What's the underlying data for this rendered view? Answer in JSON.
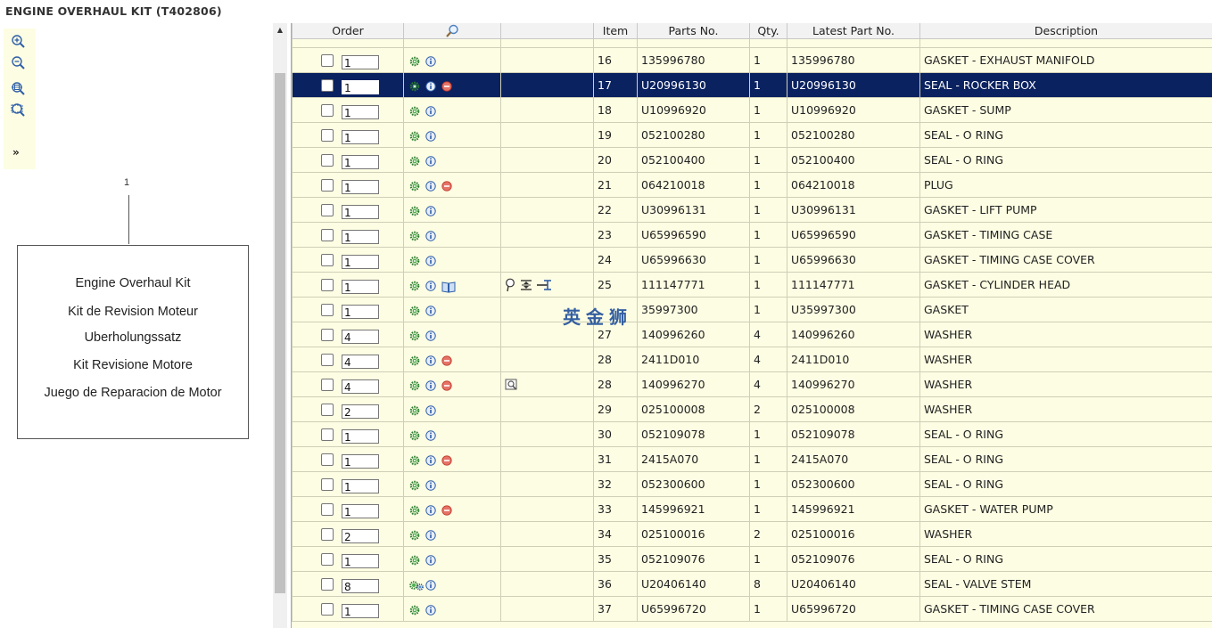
{
  "page": {
    "title": "ENGINE OVERHAUL KIT (T402806)"
  },
  "toolbar": {
    "icons": [
      "zoom-in-icon",
      "zoom-out-icon",
      "zoom-fit-icon",
      "zoom-area-icon"
    ],
    "expand_label": "»"
  },
  "illustration": {
    "callout": "1",
    "lines": [
      "Engine Overhaul Kit",
      "Kit de Revision Moteur",
      "Uberholungssatz",
      "Kit Revisione Motore",
      "Juego de Reparacion de Motor"
    ]
  },
  "watermark": "英金狮",
  "colors": {
    "row_bg": "#fdfde3",
    "selected_bg": "#0b2260",
    "icon_green": "#2e7d32",
    "icon_blue": "#2f5fa8",
    "icon_red": "#d9534f"
  },
  "table": {
    "headers": {
      "order": "Order",
      "item": "Item",
      "parts_no": "Parts No.",
      "qty": "Qty.",
      "latest": "Latest Part No.",
      "description": "Description"
    },
    "rows": [
      {
        "qty_input": "1",
        "item": "16",
        "part": "135996780",
        "qty": "1",
        "latest": "135996780",
        "desc": "GASKET - EXHAUST MANIFOLD",
        "red": false,
        "book": false,
        "extra": ""
      },
      {
        "qty_input": "1",
        "item": "17",
        "part": "U20996130",
        "qty": "1",
        "latest": "U20996130",
        "desc": "SEAL - ROCKER BOX",
        "red": true,
        "book": false,
        "extra": "",
        "selected": true
      },
      {
        "qty_input": "1",
        "item": "18",
        "part": "U10996920",
        "qty": "1",
        "latest": "U10996920",
        "desc": "GASKET - SUMP",
        "red": false,
        "book": false,
        "extra": ""
      },
      {
        "qty_input": "1",
        "item": "19",
        "part": "052100280",
        "qty": "1",
        "latest": "052100280",
        "desc": "SEAL - O RING",
        "red": false,
        "book": false,
        "extra": ""
      },
      {
        "qty_input": "1",
        "item": "20",
        "part": "052100400",
        "qty": "1",
        "latest": "052100400",
        "desc": "SEAL - O RING",
        "red": false,
        "book": false,
        "extra": ""
      },
      {
        "qty_input": "1",
        "item": "21",
        "part": "064210018",
        "qty": "1",
        "latest": "064210018",
        "desc": "PLUG",
        "red": true,
        "book": false,
        "extra": ""
      },
      {
        "qty_input": "1",
        "item": "22",
        "part": "U30996131",
        "qty": "1",
        "latest": "U30996131",
        "desc": "GASKET - LIFT PUMP",
        "red": false,
        "book": false,
        "extra": ""
      },
      {
        "qty_input": "1",
        "item": "23",
        "part": "U65996590",
        "qty": "1",
        "latest": "U65996590",
        "desc": "GASKET - TIMING CASE",
        "red": false,
        "book": false,
        "extra": ""
      },
      {
        "qty_input": "1",
        "item": "24",
        "part": "U65996630",
        "qty": "1",
        "latest": "U65996630",
        "desc": "GASKET - TIMING CASE COVER",
        "red": false,
        "book": false,
        "extra": ""
      },
      {
        "qty_input": "1",
        "item": "25",
        "part": "111147771",
        "qty": "1",
        "latest": "111147771",
        "desc": "GASKET - CYLINDER HEAD",
        "red": false,
        "book": true,
        "extra": "tools"
      },
      {
        "qty_input": "1",
        "item": "",
        "part": "35997300",
        "qty": "1",
        "latest": "U35997300",
        "desc": "GASKET",
        "red": false,
        "book": false,
        "extra": ""
      },
      {
        "qty_input": "4",
        "item": "27",
        "part": "140996260",
        "qty": "4",
        "latest": "140996260",
        "desc": "WASHER",
        "red": false,
        "book": false,
        "extra": ""
      },
      {
        "qty_input": "4",
        "item": "28",
        "part": "2411D010",
        "qty": "4",
        "latest": "2411D010",
        "desc": "WASHER",
        "red": true,
        "book": false,
        "extra": ""
      },
      {
        "qty_input": "4",
        "item": "28",
        "part": "140996270",
        "qty": "4",
        "latest": "140996270",
        "desc": "WASHER",
        "red": true,
        "book": false,
        "extra": "search"
      },
      {
        "qty_input": "2",
        "item": "29",
        "part": "025100008",
        "qty": "2",
        "latest": "025100008",
        "desc": "WASHER",
        "red": false,
        "book": false,
        "extra": ""
      },
      {
        "qty_input": "1",
        "item": "30",
        "part": "052109078",
        "qty": "1",
        "latest": "052109078",
        "desc": "SEAL - O RING",
        "red": false,
        "book": false,
        "extra": ""
      },
      {
        "qty_input": "1",
        "item": "31",
        "part": "2415A070",
        "qty": "1",
        "latest": "2415A070",
        "desc": "SEAL - O RING",
        "red": true,
        "book": false,
        "extra": ""
      },
      {
        "qty_input": "1",
        "item": "32",
        "part": "052300600",
        "qty": "1",
        "latest": "052300600",
        "desc": "SEAL - O RING",
        "red": false,
        "book": false,
        "extra": ""
      },
      {
        "qty_input": "1",
        "item": "33",
        "part": "145996921",
        "qty": "1",
        "latest": "145996921",
        "desc": "GASKET - WATER PUMP",
        "red": true,
        "book": false,
        "extra": ""
      },
      {
        "qty_input": "2",
        "item": "34",
        "part": "025100016",
        "qty": "2",
        "latest": "025100016",
        "desc": "WASHER",
        "red": false,
        "book": false,
        "extra": ""
      },
      {
        "qty_input": "1",
        "item": "35",
        "part": "052109076",
        "qty": "1",
        "latest": "052109076",
        "desc": "SEAL - O RING",
        "red": false,
        "book": false,
        "extra": ""
      },
      {
        "qty_input": "8",
        "item": "36",
        "part": "U20406140",
        "qty": "8",
        "latest": "U20406140",
        "desc": "SEAL - VALVE STEM",
        "red": false,
        "book": false,
        "extra": "",
        "multi": true
      },
      {
        "qty_input": "1",
        "item": "37",
        "part": "U65996720",
        "qty": "1",
        "latest": "U65996720",
        "desc": "GASKET - TIMING CASE COVER",
        "red": false,
        "book": false,
        "extra": ""
      }
    ]
  }
}
